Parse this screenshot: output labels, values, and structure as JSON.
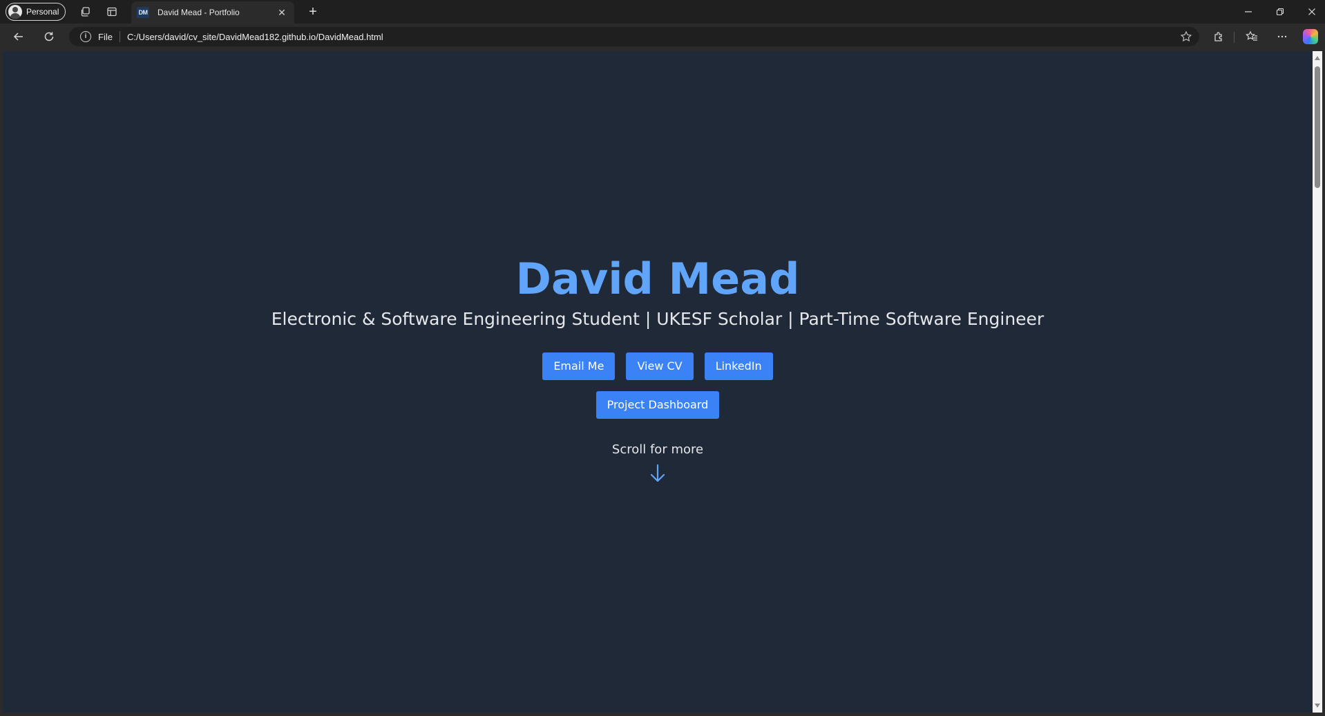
{
  "browser": {
    "profile_label": "Personal",
    "tab": {
      "favicon_text": "DM",
      "title": "David Mead - Portfolio"
    },
    "address": {
      "scheme_label": "File",
      "url": "C:/Users/david/cv_site/DavidMead182.github.io/DavidMead.html"
    },
    "icons": {
      "workspaces": "workspaces-icon",
      "tab_actions": "tab-actions-icon",
      "close_tab": "close-icon",
      "new_tab": "plus-icon",
      "back": "back-arrow-icon",
      "refresh": "refresh-icon",
      "site_info": "info-icon",
      "favorite": "star-icon",
      "extensions": "extensions-icon",
      "favorites": "favorites-icon",
      "more": "more-icon",
      "copilot": "copilot-icon",
      "minimize": "minimize-icon",
      "restore": "restore-icon",
      "close_window": "close-icon"
    }
  },
  "page": {
    "name": "David Mead",
    "tagline": "Electronic & Software Engineering Student | UKESF Scholar | Part-Time Software Engineer",
    "buttons": {
      "email": "Email Me",
      "cv": "View CV",
      "linkedin": "LinkedIn",
      "dashboard": "Project Dashboard"
    },
    "scroll_hint": "Scroll for more"
  },
  "colors": {
    "page_background": "#1f2937",
    "accent": "#60a5fa",
    "button": "#3b82f6",
    "text": "#e5e7eb"
  }
}
